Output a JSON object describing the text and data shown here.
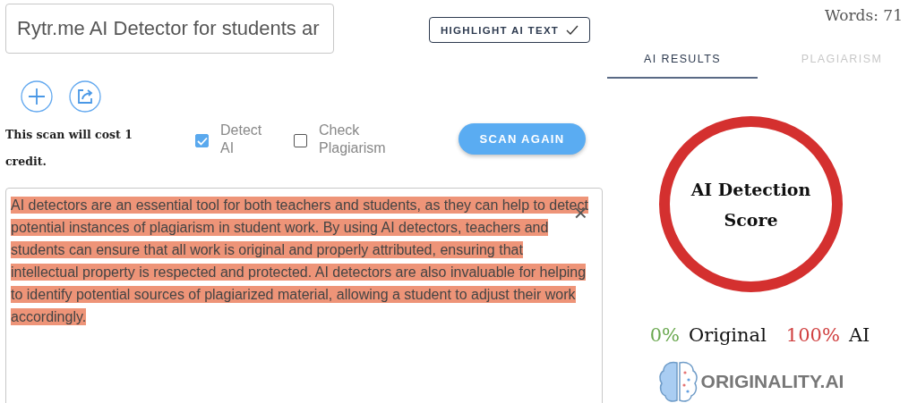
{
  "title_field": {
    "value": "Rytr.me AI Detector for students ar"
  },
  "highlight_button": {
    "label": "HIGHLIGHT AI TEXT",
    "checked": true
  },
  "word_count": "Words: 71",
  "tabs": [
    {
      "label": "AI RESULTS",
      "selected": true
    },
    {
      "label": "PLAGIARISM",
      "selected": false
    }
  ],
  "cost_note": "This scan will cost 1 credit.",
  "options": [
    {
      "label": "Detect AI",
      "checked": true
    },
    {
      "label": "Check Plagiarism",
      "checked": false
    }
  ],
  "scan_button": "SCAN AGAIN",
  "document": {
    "text": "AI detectors are an essential tool for both teachers and students, as they can help to detect potential instances of plagiarism in student work. By using AI detectors, teachers and students can ensure that all work is original and properly attributed, ensuring that intellectual property is respected and protected. AI detectors are also invaluable for helping to identify potential sources of plagiarized material, allowing a student to adjust their work accordingly.",
    "highlighted": true,
    "close": "×"
  },
  "score": {
    "title": "AI Detection Score",
    "original_value": "0%",
    "original_label": "Original",
    "ai_value": "100%",
    "ai_label": "AI"
  },
  "logo": "ORIGINALITY.AI"
}
